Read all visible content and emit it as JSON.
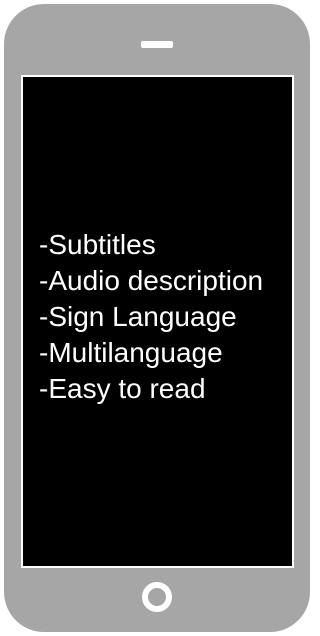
{
  "screen": {
    "features": [
      "-Subtitles",
      "-Audio description",
      "-Sign Language",
      "-Multilanguage",
      "-Easy to read"
    ]
  },
  "colors": {
    "phone_body": "#a6a6a6",
    "screen": "#000000",
    "text": "#ffffff"
  },
  "icons": {
    "speaker": "speaker-slot-icon",
    "home": "home-button-icon"
  }
}
